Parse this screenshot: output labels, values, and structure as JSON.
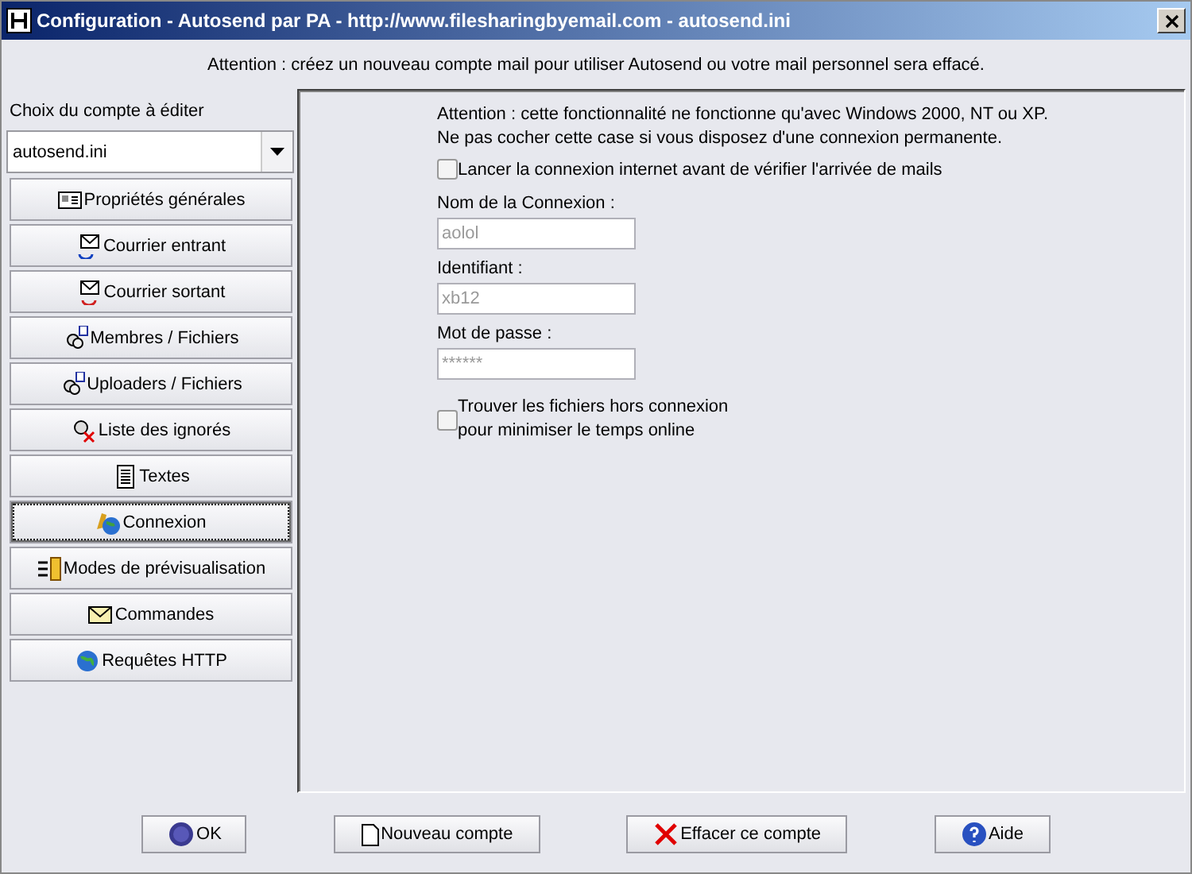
{
  "window": {
    "title": "Configuration - Autosend par PA - http://www.filesharingbyemail.com - autosend.ini"
  },
  "notice": "Attention : créez un nouveau compte mail pour utiliser Autosend ou votre mail personnel sera effacé.",
  "account": {
    "label": "Choix du compte à éditer",
    "value": "autosend.ini"
  },
  "nav": [
    {
      "label": "Propriétés générales",
      "kind": "card",
      "selected": false
    },
    {
      "label": "Courrier entrant",
      "kind": "mail-in",
      "selected": false
    },
    {
      "label": "Courrier sortant",
      "kind": "mail-out",
      "selected": false
    },
    {
      "label": "Membres / Fichiers",
      "kind": "people-down",
      "selected": false
    },
    {
      "label": "Uploaders / Fichiers",
      "kind": "people-up",
      "selected": false
    },
    {
      "label": "Liste des ignorés",
      "kind": "ignored",
      "selected": false
    },
    {
      "label": "Textes",
      "kind": "text",
      "selected": false
    },
    {
      "label": "Connexion",
      "kind": "globe-phone",
      "selected": true
    },
    {
      "label": "Modes de prévisualisation",
      "kind": "list",
      "selected": false
    },
    {
      "label": "Commandes",
      "kind": "mail-box",
      "selected": false
    },
    {
      "label": "Requêtes HTTP",
      "kind": "globe",
      "selected": false
    }
  ],
  "panel": {
    "warning": [
      "Attention : cette fonctionnalité ne fonctionne qu'avec Windows 2000, NT ou XP.",
      "Ne pas cocher cette case si vous disposez d'une connexion permanente."
    ],
    "launch": {
      "label": "Lancer la connexion internet avant de vérifier l'arrivée de mails",
      "checked": false
    },
    "fields": [
      {
        "label": "Nom de la Connexion :",
        "value": "aolol",
        "disabled": true
      },
      {
        "label": "Identifiant :",
        "value": "xb12",
        "disabled": true
      },
      {
        "label": "Mot de passe :",
        "value": "******",
        "disabled": true
      }
    ],
    "offline": {
      "label": [
        "Trouver les fichiers hors connexion",
        "pour minimiser le temps online"
      ],
      "checked": false
    }
  },
  "buttons": [
    {
      "label": "OK",
      "kind": "go"
    },
    {
      "label": "Nouveau compte",
      "kind": "new"
    },
    {
      "label": "Effacer ce compte",
      "kind": "delete"
    },
    {
      "label": "Aide",
      "kind": "help"
    }
  ]
}
